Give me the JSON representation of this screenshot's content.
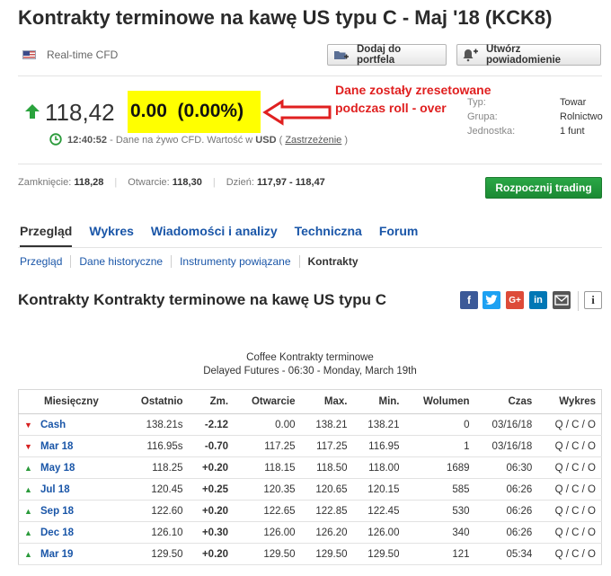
{
  "title": "Kontrakty terminowe na kawę US typu C - Maj '18 (KCK8)",
  "realtime_label": "Real-time CFD",
  "buttons": {
    "portfolio": "Dodaj do portfela",
    "alert": "Utwórz powiadomienie",
    "start_trading": "Rozpocznij trading"
  },
  "price": {
    "last": "118,42",
    "change": "0.00  (0.00%)",
    "direction": "up",
    "time": "12:40:52",
    "time_note": " - Dane na żywo CFD. Wartość w ",
    "currency": "USD",
    "disclaimer_open": " ( ",
    "disclaimer": "Zastrzeżenie",
    "disclaimer_close": " )"
  },
  "annotation": {
    "line1": "Dane zostały zresetowane",
    "line2": "podczas roll - over",
    "color": "#e02020"
  },
  "meta": [
    {
      "label": "Typ:",
      "value": "Towar"
    },
    {
      "label": "Grupa:",
      "value": "Rolnictwo"
    },
    {
      "label": "Jednostka:",
      "value": "1 funt"
    }
  ],
  "stats": {
    "close_label": "Zamknięcie:",
    "close_value": "118,28",
    "open_label": "Otwarcie:",
    "open_value": "118,30",
    "day_label": "Dzień:",
    "day_value": "117,97 - 118,47"
  },
  "tabs": [
    "Przegląd",
    "Wykres",
    "Wiadomości i analizy",
    "Techniczna",
    "Forum"
  ],
  "subtabs": [
    "Przegląd",
    "Dane historyczne",
    "Instrumenty powiązane",
    "Kontrakty"
  ],
  "section_title": "Kontrakty Kontrakty terminowe na kawę US typu C",
  "share": {
    "facebook": "f",
    "twitter": "t",
    "googleplus": "G+",
    "linkedin": "in",
    "info": "i"
  },
  "table_caption": {
    "line1": "Coffee Kontrakty terminowe",
    "line2": "Delayed Futures - 06:30 - Monday, March 19th"
  },
  "table": {
    "headers": [
      "Miesięczny",
      "Ostatnio",
      "Zm.",
      "Otwarcie",
      "Max.",
      "Min.",
      "Wolumen",
      "Czas",
      "Wykres"
    ],
    "rows": [
      {
        "month": "Cash",
        "dir": "down",
        "last": "138.21s",
        "change": "-2.12",
        "open": "0.00",
        "high": "138.21",
        "low": "138.21",
        "volume": "0",
        "time": "03/16/18",
        "chart": "Q / C / O"
      },
      {
        "month": "Mar 18",
        "dir": "down",
        "last": "116.95s",
        "change": "-0.70",
        "open": "117.25",
        "high": "117.25",
        "low": "116.95",
        "volume": "1",
        "time": "03/16/18",
        "chart": "Q / C / O"
      },
      {
        "month": "May 18",
        "dir": "up",
        "last": "118.25",
        "change": "+0.20",
        "open": "118.15",
        "high": "118.50",
        "low": "118.00",
        "volume": "1689",
        "time": "06:30",
        "chart": "Q / C / O"
      },
      {
        "month": "Jul 18",
        "dir": "up",
        "last": "120.45",
        "change": "+0.25",
        "open": "120.35",
        "high": "120.65",
        "low": "120.15",
        "volume": "585",
        "time": "06:26",
        "chart": "Q / C / O"
      },
      {
        "month": "Sep 18",
        "dir": "up",
        "last": "122.60",
        "change": "+0.20",
        "open": "122.65",
        "high": "122.85",
        "low": "122.45",
        "volume": "530",
        "time": "06:26",
        "chart": "Q / C / O"
      },
      {
        "month": "Dec 18",
        "dir": "up",
        "last": "126.10",
        "change": "+0.30",
        "open": "126.00",
        "high": "126.20",
        "low": "126.00",
        "volume": "340",
        "time": "06:26",
        "chart": "Q / C / O"
      },
      {
        "month": "Mar 19",
        "dir": "up",
        "last": "129.50",
        "change": "+0.20",
        "open": "129.50",
        "high": "129.50",
        "low": "129.50",
        "volume": "121",
        "time": "05:34",
        "chart": "Q / C / O"
      }
    ]
  }
}
